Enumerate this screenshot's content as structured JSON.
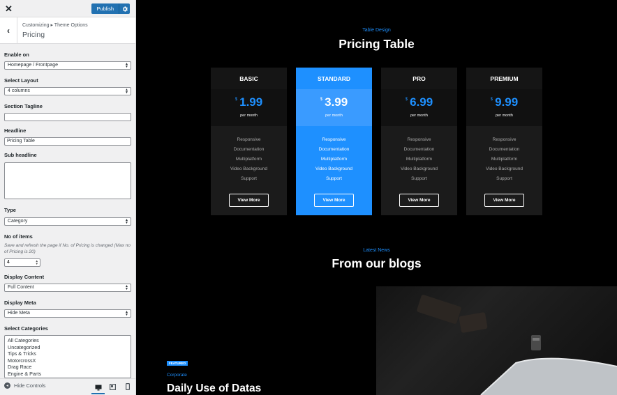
{
  "sidebar": {
    "publish_label": "Publish",
    "breadcrumb": "Customizing ▸ Theme Options",
    "section_title": "Pricing",
    "enable_on": {
      "label": "Enable on",
      "value": "Homepage / Frontpage"
    },
    "layout": {
      "label": "Select Layout",
      "value": "4 columns"
    },
    "tagline": {
      "label": "Section Tagline",
      "value": ""
    },
    "headline": {
      "label": "Headline",
      "value": "Pricing Table"
    },
    "subheadline": {
      "label": "Sub headline",
      "value": ""
    },
    "type": {
      "label": "Type",
      "value": "Category"
    },
    "items": {
      "label": "No of items",
      "description": "Save and refresh the page if No. of Pricing is changed (Max no of Pricing is 20)",
      "value": "4"
    },
    "display_content": {
      "label": "Display Content",
      "value": "Full Content"
    },
    "display_meta": {
      "label": "Display Meta",
      "value": "Hide Meta"
    },
    "categories": {
      "label": "Select Categories",
      "options": [
        "All Categories",
        "Uncategorized",
        "Tips & Tricks",
        "MotorcrossX",
        "Drag Race",
        "Engine & Parts"
      ]
    },
    "footer": {
      "hide_controls": "Hide Controls"
    }
  },
  "preview": {
    "pricing": {
      "tagline": "Table Design",
      "title": "Pricing Table",
      "currency": "$",
      "period": "per month",
      "button_label": "View More",
      "plans": [
        {
          "name": "BASIC",
          "price": "1.99",
          "features": [
            "Responsive",
            "Documentation",
            "Multiplatform",
            "Video Background",
            "Support"
          ]
        },
        {
          "name": "STANDARD",
          "price": "3.99",
          "features": [
            "Responsive",
            "Documentation",
            "Multiplatform",
            "Video Background",
            "Support"
          ]
        },
        {
          "name": "PRO",
          "price": "6.99",
          "features": [
            "Responsive",
            "Documentation",
            "Multiplatform",
            "Video Background",
            "Support"
          ]
        },
        {
          "name": "PREMIUM",
          "price": "9.99",
          "features": [
            "Responsive",
            "Documentation",
            "Multiplatform",
            "Video Background",
            "Support"
          ]
        }
      ]
    },
    "blog": {
      "tagline": "Latest News",
      "title": "From our blogs",
      "badge": "FEATURED",
      "category": "Corporate",
      "post_title": "Daily Use of Datas"
    }
  },
  "colors": {
    "accent": "#1e90ff",
    "wp_blue": "#2271b1",
    "background": "#000000"
  }
}
